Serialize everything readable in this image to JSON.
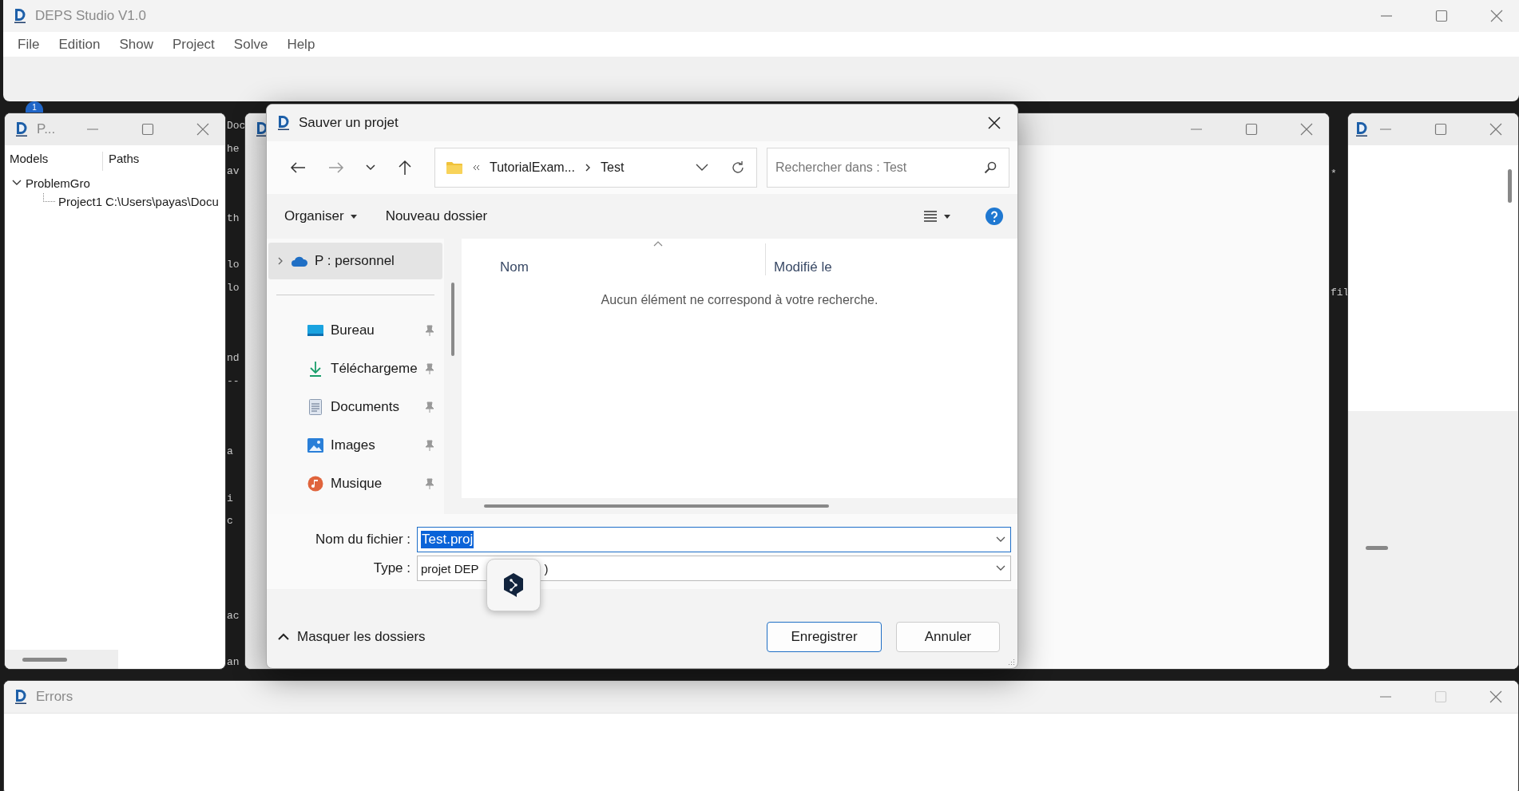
{
  "main_window": {
    "title": "DEPS Studio V1.0",
    "menu": [
      "File",
      "Edition",
      "Show",
      "Project",
      "Solve",
      "Help"
    ],
    "badge": "1"
  },
  "project_window": {
    "title": "P...",
    "columns": [
      "Models",
      "Paths"
    ],
    "tree": [
      {
        "label": "ProblemGro",
        "expanded": true,
        "children": [
          {
            "label": "Project1",
            "path": "C:\\Users\\payas\\Docu"
          }
        ]
      }
    ]
  },
  "editor_window": {
    "code_left": [
      "Doc",
      "he",
      "av",
      "th",
      "lo",
      "lo",
      "nd",
      "--",
      "a",
      "i",
      "c",
      "ac",
      "an"
    ],
    "code_right": [
      "*",
      "fil"
    ]
  },
  "dialog": {
    "title": "Sauver un projet",
    "breadcrumb": [
      "TutorialExam...",
      "Test"
    ],
    "search": {
      "placeholder": "Rechercher dans : Test"
    },
    "commands": [
      "Organiser",
      "Nouveau dossier"
    ],
    "nav": [
      {
        "label": "P : personnel",
        "kind": "cloud",
        "selected": true,
        "pinned": false
      },
      {
        "label": "Bureau",
        "kind": "desktop",
        "selected": false,
        "pinned": true
      },
      {
        "label": "Téléchargeme",
        "kind": "download",
        "selected": false,
        "pinned": true
      },
      {
        "label": "Documents",
        "kind": "document",
        "selected": false,
        "pinned": true
      },
      {
        "label": "Images",
        "kind": "image",
        "selected": false,
        "pinned": true
      },
      {
        "label": "Musique",
        "kind": "music",
        "selected": false,
        "pinned": true
      }
    ],
    "columns": [
      "Nom",
      "Modifié le"
    ],
    "empty_message": "Aucun élément ne correspond à votre recherche.",
    "filename": {
      "label": "Nom du fichier :",
      "value": "Test.proj",
      "text_selected": true
    },
    "type": {
      "label": "Type :",
      "value_parts": [
        "projet DEP",
        ")"
      ]
    },
    "toggle": "Masquer les dossiers",
    "buttons": [
      {
        "label": "Enregistrer",
        "default": true
      },
      {
        "label": "Annuler",
        "default": false
      }
    ]
  },
  "errors_window": {
    "title": "Errors"
  }
}
